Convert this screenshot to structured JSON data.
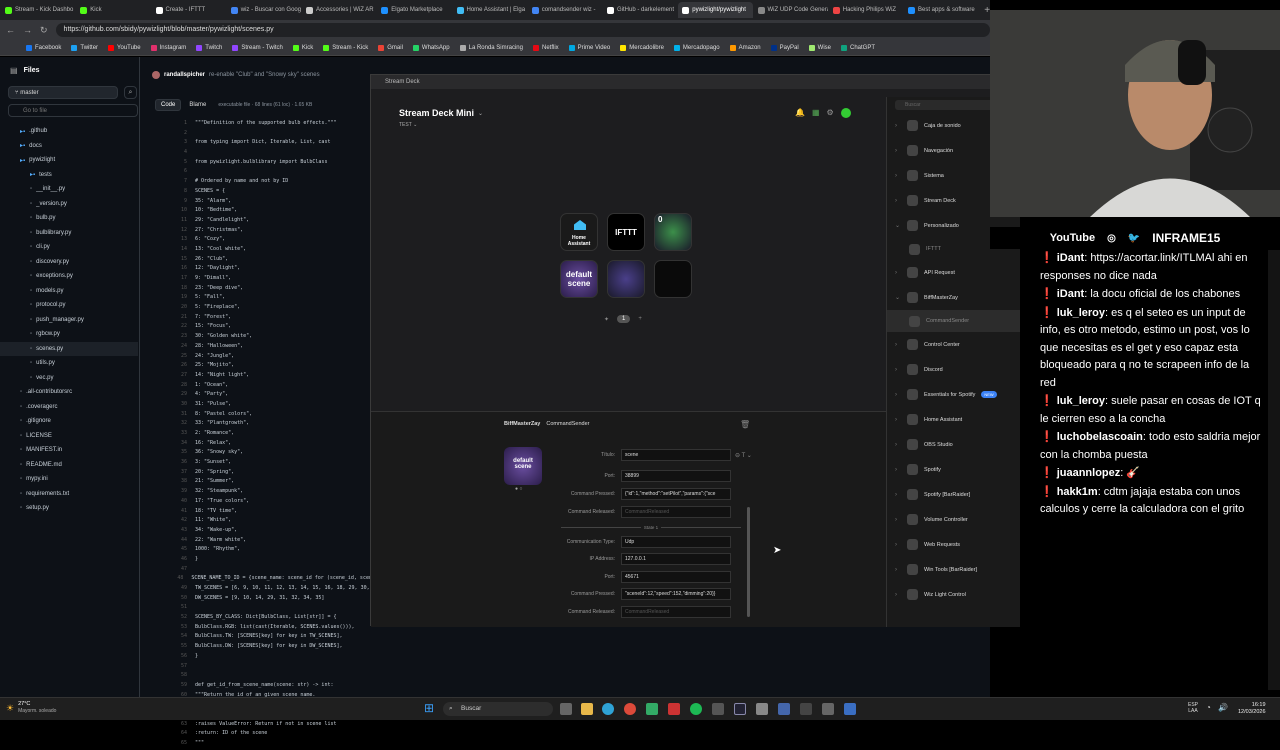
{
  "browser": {
    "tabs": [
      {
        "label": "Stream - Kick Dashbo",
        "color": "#53fc18"
      },
      {
        "label": "Kick",
        "color": "#53fc18"
      },
      {
        "label": "Create - IFTTT",
        "color": "#ffffff"
      },
      {
        "label": "wiz - Buscar con Goog",
        "color": "#4285f4"
      },
      {
        "label": "Accessories | WiZ AR",
        "color": "#cccccc"
      },
      {
        "label": "Elgato Marketplace",
        "color": "#1e90ff"
      },
      {
        "label": "Home Assistant | Elga",
        "color": "#41bdf5"
      },
      {
        "label": "comandsender wiz - ",
        "color": "#4285f4"
      },
      {
        "label": "GitHub - darkelement",
        "color": "#ffffff"
      },
      {
        "label": "pywizlight/pywizlight",
        "color": "#ffffff"
      },
      {
        "label": "WiZ UDP Code Genera",
        "color": "#888888"
      },
      {
        "label": "Hacking Philips WiZ",
        "color": "#e44"
      },
      {
        "label": "Best apps & software",
        "color": "#1e90ff"
      }
    ],
    "url": "https://github.com/sbidy/pywizlight/blob/master/pywizlight/scenes.py",
    "bookmarks": [
      {
        "label": "Facebook",
        "color": "#1877f2"
      },
      {
        "label": "Twitter",
        "color": "#1da1f2"
      },
      {
        "label": "YouTube",
        "color": "#ff0000"
      },
      {
        "label": "Instagram",
        "color": "#e1306c"
      },
      {
        "label": "Twitch",
        "color": "#9146ff"
      },
      {
        "label": "Stream - Twitch",
        "color": "#9146ff"
      },
      {
        "label": "Kick",
        "color": "#53fc18"
      },
      {
        "label": "Stream - Kick",
        "color": "#53fc18"
      },
      {
        "label": "Gmail",
        "color": "#ea4335"
      },
      {
        "label": "WhatsApp",
        "color": "#25d366"
      },
      {
        "label": "La Ronda Simracing",
        "color": "#aaaaaa"
      },
      {
        "label": "Netflix",
        "color": "#e50914"
      },
      {
        "label": "Prime Video",
        "color": "#00a8e1"
      },
      {
        "label": "Mercadolibre",
        "color": "#ffe600"
      },
      {
        "label": "Mercadopago",
        "color": "#00b1ea"
      },
      {
        "label": "Amazon",
        "color": "#ff9900"
      },
      {
        "label": "PayPal",
        "color": "#003087"
      },
      {
        "label": "Wise",
        "color": "#9fe870"
      },
      {
        "label": "ChatGPT",
        "color": "#10a37f"
      }
    ]
  },
  "github": {
    "files_title": "Files",
    "branch": "master",
    "goto_placeholder": "Go to file",
    "tree": [
      {
        "name": ".github",
        "indent": 1,
        "type": "folder"
      },
      {
        "name": "docs",
        "indent": 1,
        "type": "folder"
      },
      {
        "name": "pywizlight",
        "indent": 1,
        "type": "folder"
      },
      {
        "name": "tests",
        "indent": 2,
        "type": "folder"
      },
      {
        "name": "__init__.py",
        "indent": 2,
        "type": "file"
      },
      {
        "name": "_version.py",
        "indent": 2,
        "type": "file"
      },
      {
        "name": "bulb.py",
        "indent": 2,
        "type": "file"
      },
      {
        "name": "bulblibrary.py",
        "indent": 2,
        "type": "file"
      },
      {
        "name": "cli.py",
        "indent": 2,
        "type": "file"
      },
      {
        "name": "discovery.py",
        "indent": 2,
        "type": "file"
      },
      {
        "name": "exceptions.py",
        "indent": 2,
        "type": "file"
      },
      {
        "name": "models.py",
        "indent": 2,
        "type": "file"
      },
      {
        "name": "protocol.py",
        "indent": 2,
        "type": "file"
      },
      {
        "name": "push_manager.py",
        "indent": 2,
        "type": "file"
      },
      {
        "name": "rgbcw.py",
        "indent": 2,
        "type": "file"
      },
      {
        "name": "scenes.py",
        "indent": 2,
        "type": "file",
        "selected": true
      },
      {
        "name": "utils.py",
        "indent": 2,
        "type": "file"
      },
      {
        "name": "vec.py",
        "indent": 2,
        "type": "file"
      },
      {
        "name": ".all-contributorsrc",
        "indent": 1,
        "type": "file"
      },
      {
        "name": ".coveragerc",
        "indent": 1,
        "type": "file"
      },
      {
        "name": ".gitignore",
        "indent": 1,
        "type": "file"
      },
      {
        "name": "LICENSE",
        "indent": 1,
        "type": "file"
      },
      {
        "name": "MANIFEST.in",
        "indent": 1,
        "type": "file"
      },
      {
        "name": "README.md",
        "indent": 1,
        "type": "file"
      },
      {
        "name": "mypy.ini",
        "indent": 1,
        "type": "file"
      },
      {
        "name": "requirements.txt",
        "indent": 1,
        "type": "file"
      },
      {
        "name": "setup.py",
        "indent": 1,
        "type": "file"
      }
    ],
    "commit_author": "randallspicher",
    "commit_msg": "re-enable \"Club\" and \"Snowy sky\" scenes",
    "code_tab": "Code",
    "blame_tab": "Blame",
    "file_info": "executable file · 68 lines (61 loc) · 1.65 KB",
    "code_lines": [
      {
        "n": "1",
        "t": "\"\"\"Definition of the supported bulb effects.\"\"\""
      },
      {
        "n": "2",
        "t": ""
      },
      {
        "n": "3",
        "t": "from typing import Dict, Iterable, List, cast"
      },
      {
        "n": "4",
        "t": ""
      },
      {
        "n": "5",
        "t": "from pywizlight.bulblibrary import BulbClass"
      },
      {
        "n": "6",
        "t": ""
      },
      {
        "n": "7",
        "t": "# Ordered by name and not by ID"
      },
      {
        "n": "8",
        "t": "SCENES = {"
      },
      {
        "n": "9",
        "t": "    35: \"Alarm\","
      },
      {
        "n": "10",
        "t": "    10: \"Bedtime\","
      },
      {
        "n": "11",
        "t": "    29: \"Candlelight\","
      },
      {
        "n": "12",
        "t": "    27: \"Christmas\","
      },
      {
        "n": "13",
        "t": "    6: \"Cozy\","
      },
      {
        "n": "14",
        "t": "    13: \"Cool white\","
      },
      {
        "n": "15",
        "t": "    26: \"Club\","
      },
      {
        "n": "16",
        "t": "    12: \"Daylight\","
      },
      {
        "n": "17",
        "t": "    9: \"Dimall\","
      },
      {
        "n": "18",
        "t": "    23: \"Deep dive\","
      },
      {
        "n": "19",
        "t": "    5: \"Fall\","
      },
      {
        "n": "20",
        "t": "    5: \"Fireplace\","
      },
      {
        "n": "21",
        "t": "    7: \"Forest\","
      },
      {
        "n": "22",
        "t": "    15: \"Focus\","
      },
      {
        "n": "23",
        "t": "    30: \"Golden white\","
      },
      {
        "n": "24",
        "t": "    28: \"Halloween\","
      },
      {
        "n": "25",
        "t": "    24: \"Jungle\","
      },
      {
        "n": "26",
        "t": "    25: \"Mojito\","
      },
      {
        "n": "27",
        "t": "    14: \"Night light\","
      },
      {
        "n": "28",
        "t": "    1: \"Ocean\","
      },
      {
        "n": "29",
        "t": "    4: \"Party\","
      },
      {
        "n": "30",
        "t": "    31: \"Pulse\","
      },
      {
        "n": "31",
        "t": "    8: \"Pastel colors\","
      },
      {
        "n": "32",
        "t": "    33: \"Plantgrowth\","
      },
      {
        "n": "33",
        "t": "    2: \"Romance\","
      },
      {
        "n": "34",
        "t": "    16: \"Relax\","
      },
      {
        "n": "35",
        "t": "    36: \"Snowy sky\","
      },
      {
        "n": "36",
        "t": "    3: \"Sunset\","
      },
      {
        "n": "37",
        "t": "    20: \"Spring\","
      },
      {
        "n": "38",
        "t": "    21: \"Summer\","
      },
      {
        "n": "39",
        "t": "    32: \"Steampunk\","
      },
      {
        "n": "40",
        "t": "    17: \"True colors\","
      },
      {
        "n": "41",
        "t": "    18: \"TV time\","
      },
      {
        "n": "42",
        "t": "    11: \"White\","
      },
      {
        "n": "43",
        "t": "    34: \"Wake-up\","
      },
      {
        "n": "44",
        "t": "    22: \"Warm white\","
      },
      {
        "n": "45",
        "t": "    1000: \"Rhythm\","
      },
      {
        "n": "46",
        "t": "}"
      },
      {
        "n": "47",
        "t": ""
      },
      {
        "n": "48",
        "t": "SCENE_NAME_TO_ID = {scene_name: scene_id for (scene_id, scene"
      },
      {
        "n": "49",
        "t": "TW_SCENES = [6, 9, 10, 11, 12, 13, 14, 15, 16, 18, 29, 30,"
      },
      {
        "n": "50",
        "t": "DW_SCENES = [9, 10, 14, 29, 31, 32, 34, 35]"
      },
      {
        "n": "51",
        "t": ""
      },
      {
        "n": "52",
        "t": "SCENES_BY_CLASS: Dict[BulbClass, List[str]] = {"
      },
      {
        "n": "53",
        "t": "    BulbClass.RGB: list(cast(Iterable, SCENES.values())),"
      },
      {
        "n": "54",
        "t": "    BulbClass.TW: [SCENES[key] for key in TW_SCENES],"
      },
      {
        "n": "55",
        "t": "    BulbClass.DW: [SCENES[key] for key in DW_SCENES],"
      },
      {
        "n": "56",
        "t": "}"
      },
      {
        "n": "57",
        "t": ""
      },
      {
        "n": "58",
        "t": ""
      },
      {
        "n": "59",
        "t": "def get_id_from_scene_name(scene: str) -> int:"
      },
      {
        "n": "60",
        "t": "    \"\"\"Return the id of an given scene name."
      },
      {
        "n": "61",
        "t": ""
      },
      {
        "n": "62",
        "t": "    :param scene: Name of the scene"
      },
      {
        "n": "63",
        "t": "    :raises ValueError: Return if not in scene list"
      },
      {
        "n": "64",
        "t": "    :return: ID of the scene"
      },
      {
        "n": "65",
        "t": "    \"\"\""
      }
    ]
  },
  "streamdeck": {
    "window_title": "Stream Deck",
    "device": "Stream Deck Mini",
    "profile": "TEST",
    "keys": [
      {
        "label": "Home Assistant",
        "kind": "ha"
      },
      {
        "label": "IFTTT",
        "kind": "text"
      },
      {
        "label": "0",
        "kind": "wiz"
      },
      {
        "label": "default scene",
        "kind": "scene"
      },
      {
        "label": "",
        "kind": "wiz2"
      },
      {
        "label": "",
        "kind": "empty"
      }
    ],
    "page_number": "1",
    "search_placeholder": "Buscar",
    "plugins": [
      {
        "label": "Caja de sonido",
        "expanded": false
      },
      {
        "label": "Navegación",
        "expanded": false
      },
      {
        "label": "Sistema",
        "expanded": false
      },
      {
        "label": "Stream Deck",
        "expanded": false
      },
      {
        "label": "Personalizado",
        "expanded": true
      },
      {
        "label": "IFTTT",
        "sub": true
      },
      {
        "label": "API Request",
        "expanded": false
      },
      {
        "label": "BiffMasterZay",
        "expanded": true
      },
      {
        "label": "CommandSender",
        "sub": true
      },
      {
        "label": "Control Center",
        "expanded": false
      },
      {
        "label": "Discord",
        "expanded": false
      },
      {
        "label": "Essentials for Spotify",
        "expanded": false,
        "badge": "NEW"
      },
      {
        "label": "Home Assistant",
        "expanded": false
      },
      {
        "label": "OBS Studio",
        "expanded": false
      },
      {
        "label": "Spotify",
        "expanded": false
      },
      {
        "label": "Spotify [BarRaider]",
        "expanded": false
      },
      {
        "label": "Volume Controller",
        "expanded": false
      },
      {
        "label": "Web Requests",
        "expanded": false
      },
      {
        "label": "Win Tools [BarRaider]",
        "expanded": false
      },
      {
        "label": "Wiz Light Control",
        "expanded": false
      }
    ],
    "inspector": {
      "plugin": "BiffMasterZay",
      "action": "CommandSender",
      "title_label": "Título:",
      "title_value": "scene",
      "port_label": "Port:",
      "port_value": "38899",
      "cmd_pressed_label": "Command Pressed:",
      "cmd_pressed_value": "{\"id\":1,\"method\":\"setPilot\",\"params\":{\"sce",
      "cmd_released_label": "Command Released:",
      "cmd_released_placeholder": "CommandReleased",
      "state_label": "State 1",
      "comm_type_label": "Communication Type:",
      "comm_type_value": "Udp",
      "ip_label": "IP Address:",
      "ip_value": "127.0.0.1",
      "port2_label": "Port:",
      "port2_value": "45671",
      "cmd_pressed2_label": "Command Pressed:",
      "cmd_pressed2_value": "\"sceneId\":12,\"speed\":152,\"dimming\":20}}",
      "cmd_released2_label": "Command Released:",
      "cmd_released2_placeholder": "CommandReleased",
      "icon_label": "default scene"
    }
  },
  "stream": {
    "socials": [
      "YouTube",
      "INFRAME15"
    ],
    "chat": [
      {
        "user": "iDant",
        "text": ": https://acortar.link/ITLMAl ahi en responses no dice nada",
        "color": "#ffffff"
      },
      {
        "user": "iDant",
        "text": ": la docu oficial de los chabones",
        "color": "#ffffff"
      },
      {
        "user": "luk_leroy",
        "text": ": es q el seteo es un input de info, es otro metodo, estimo un post, vos lo que necesitas es el get y eso capaz esta bloqueado para q no te scrapeen info de la red",
        "color": "#ffffff"
      },
      {
        "user": "luk_leroy",
        "text": ": suele pasar en cosas de IOT q le cierren eso a la concha",
        "color": "#ffffff"
      },
      {
        "user": "luchobelascoain",
        "text": ": todo esto saldria mejor con la chomba puesta",
        "color": "#ffffff"
      },
      {
        "user": "juaannlopez",
        "text": ": 🎸",
        "color": "#ffffff"
      },
      {
        "user": "hakk1m",
        "text": ": cdtm jajaja estaba con unos calculos y cerre la calculadora con el grito",
        "color": "#ffffff"
      }
    ]
  },
  "taskbar": {
    "weather_temp": "27°C",
    "weather_desc": "Mayorm. soleado",
    "search_label": "Buscar",
    "lang": "ESP",
    "lang2": "LAA",
    "time": "16:19",
    "date": "12/03/2026"
  }
}
